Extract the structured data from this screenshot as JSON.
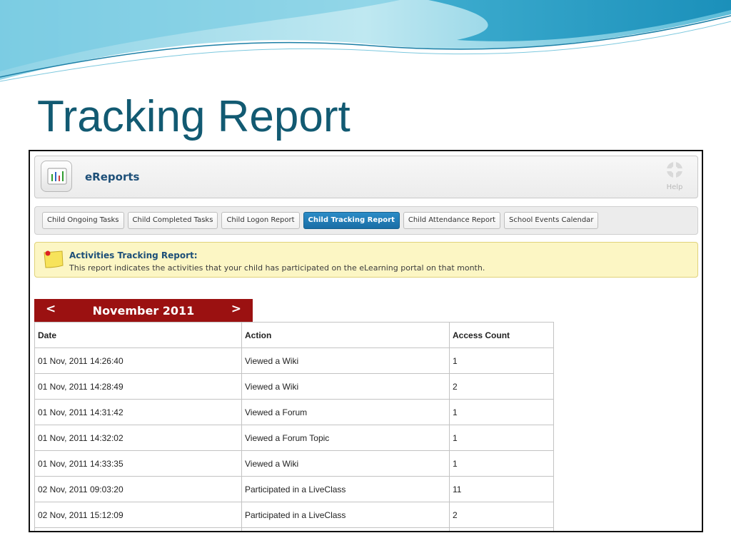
{
  "slide": {
    "title": "Tracking Report"
  },
  "app": {
    "name": "eReports",
    "help_label": "Help",
    "icon": "report-chart-icon"
  },
  "tabs": [
    {
      "label": "Child Ongoing Tasks",
      "active": false
    },
    {
      "label": "Child Completed Tasks",
      "active": false
    },
    {
      "label": "Child Logon Report",
      "active": false
    },
    {
      "label": "Child Tracking Report",
      "active": true
    },
    {
      "label": "Child Attendance Report",
      "active": false
    },
    {
      "label": "School Events Calendar",
      "active": false
    }
  ],
  "notice": {
    "title": "Activities Tracking Report:",
    "text": "This report indicates the activities that your child has participated on the eLearning portal on that month.",
    "icon": "sticky-note-icon"
  },
  "calendar": {
    "prev": "<",
    "month": "November 2011",
    "next": ">"
  },
  "table": {
    "headers": [
      "Date",
      "Action",
      "Access Count"
    ],
    "rows": [
      [
        "01 Nov, 2011 14:26:40",
        "Viewed a Wiki",
        "1"
      ],
      [
        "01 Nov, 2011 14:28:49",
        "Viewed a Wiki",
        "2"
      ],
      [
        "01 Nov, 2011 14:31:42",
        "Viewed a Forum",
        "1"
      ],
      [
        "01 Nov, 2011 14:32:02",
        "Viewed a Forum Topic",
        "1"
      ],
      [
        "01 Nov, 2011 14:33:35",
        "Viewed a Wiki",
        "1"
      ],
      [
        "02 Nov, 2011 09:03:20",
        "Participated in a LiveClass",
        "11"
      ],
      [
        "02 Nov, 2011 15:12:09",
        "Participated in a LiveClass",
        "2"
      ],
      [
        "",
        "",
        ""
      ]
    ]
  },
  "colors": {
    "title": "#125a72",
    "accent_tab": "#1a6ea6",
    "month_bar": "#9b1111",
    "notice_bg": "#fcf6c4"
  }
}
